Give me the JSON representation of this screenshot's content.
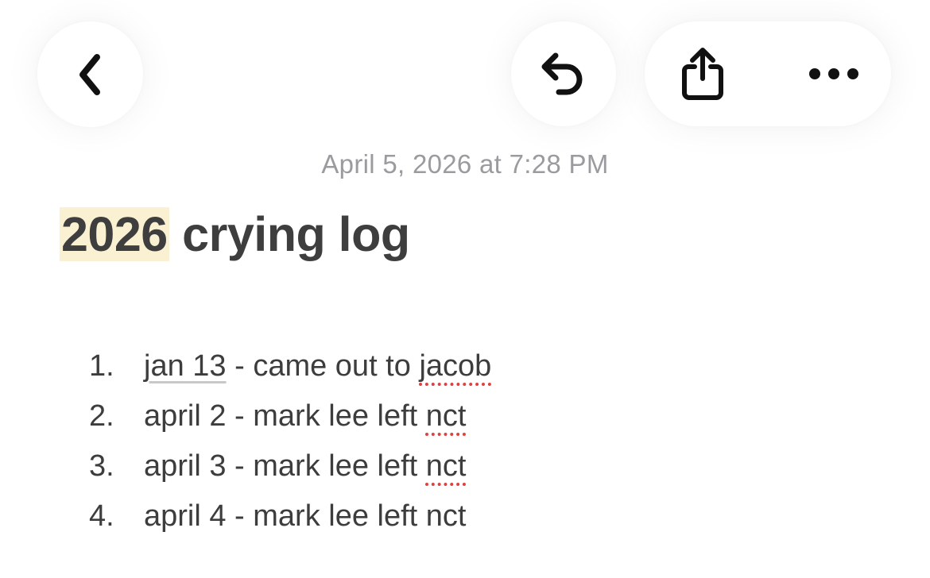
{
  "toolbar": {
    "back_icon": "chevron-left-icon",
    "undo_icon": "undo-arrow-icon",
    "share_icon": "share-icon",
    "more_icon": "ellipsis-icon"
  },
  "note": {
    "timestamp": "April 5, 2026 at 7:28 PM",
    "title_highlight": "2026",
    "title_rest": " crying log",
    "highlight_color": "#faf0d2",
    "items": [
      {
        "number": "1.",
        "date": "jan 13",
        "sep": " - came out to ",
        "text": "",
        "flagged": "jacob"
      },
      {
        "number": "2.",
        "date": "",
        "sep": "",
        "text": "april 2 - mark lee left ",
        "flagged": "nct"
      },
      {
        "number": "3.",
        "date": "",
        "sep": "",
        "text": "april 3 - mark lee left ",
        "flagged": "nct"
      },
      {
        "number": "4.",
        "date": "",
        "sep": "",
        "text": "april 4 - mark lee left nct",
        "flagged": ""
      }
    ]
  },
  "colors": {
    "text": "#3e3e3e",
    "timestamp": "#9b9b9f",
    "spellcheck": "#e2403f"
  }
}
